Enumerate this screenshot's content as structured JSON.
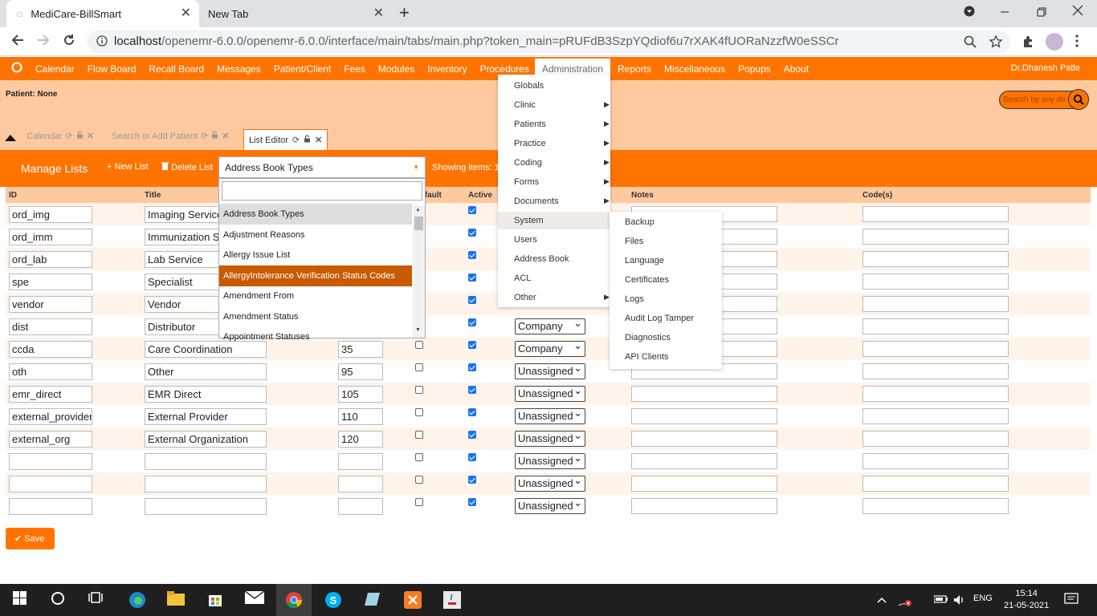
{
  "browser": {
    "tabs": [
      {
        "title": "MediCare-BillSmart"
      },
      {
        "title": "New Tab"
      }
    ],
    "url_host": "localhost",
    "url_path": "/openemr-6.0.0/openemr-6.0.0/interface/main/tabs/main.php?token_main=pRUFdB3SzpYQdiof6u7rXAK4fUORaNzzfW0eSSCr",
    "new_tab_glyph": "+",
    "close_glyph": "✕"
  },
  "menu": {
    "items": [
      "Calendar",
      "Flow Board",
      "Recall Board",
      "Messages",
      "Patient/Client",
      "Fees",
      "Modules",
      "Inventory",
      "Procedures"
    ],
    "active": "Administration",
    "items_after": [
      "Reports",
      "Miscellaneous",
      "Popups",
      "About"
    ],
    "user": "Dr.Dhanesh Patle"
  },
  "patient": {
    "label": "Patient: None",
    "search_placeholder": "Search by any de"
  },
  "page_tabs": [
    {
      "label": "Calendar"
    },
    {
      "label": "Search or Add Patient"
    },
    {
      "label": "List Editor"
    }
  ],
  "list_bar": {
    "title": "Manage Lists",
    "new_list": "New List",
    "delete_list": "Delete List",
    "selected_list": "Address Book Types",
    "showing": "Showing items: 1"
  },
  "table": {
    "headers": {
      "id": "ID",
      "title": "Title",
      "default": "Default",
      "active": "Active",
      "notes": "Notes",
      "codes": "Code(s)"
    },
    "rows": [
      {
        "id": "ord_img",
        "title": "Imaging Service",
        "order": "",
        "active": true,
        "type": ""
      },
      {
        "id": "ord_imm",
        "title": "Immunization Service",
        "order": "",
        "active": true,
        "type": ""
      },
      {
        "id": "ord_lab",
        "title": "Lab Service",
        "order": "",
        "active": true,
        "type": ""
      },
      {
        "id": "spe",
        "title": "Specialist",
        "order": "",
        "active": true,
        "type": ""
      },
      {
        "id": "vendor",
        "title": "Vendor",
        "order": "",
        "active": true,
        "type": ""
      },
      {
        "id": "dist",
        "title": "Distributor",
        "order": "",
        "active": true,
        "type": "Company"
      },
      {
        "id": "ccda",
        "title": "Care Coordination",
        "order": "35",
        "active": true,
        "type": "Company"
      },
      {
        "id": "oth",
        "title": "Other",
        "order": "95",
        "active": true,
        "type": "Unassigned"
      },
      {
        "id": "emr_direct",
        "title": "EMR Direct",
        "order": "105",
        "active": true,
        "type": "Unassigned"
      },
      {
        "id": "external_provider",
        "title": "External Provider",
        "order": "110",
        "active": true,
        "type": "Unassigned"
      },
      {
        "id": "external_org",
        "title": "External Organization",
        "order": "120",
        "active": true,
        "type": "Unassigned"
      },
      {
        "id": "",
        "title": "",
        "order": "",
        "active": true,
        "type": "Unassigned"
      },
      {
        "id": "",
        "title": "",
        "order": "",
        "active": true,
        "type": "Unassigned"
      },
      {
        "id": "",
        "title": "",
        "order": "",
        "active": true,
        "type": "Unassigned"
      }
    ]
  },
  "save_label": "Save",
  "list_dropdown": {
    "options": [
      "Address Book Types",
      "Adjustment Reasons",
      "Allergy Issue List",
      "AllergyIntolerance Verification Status Codes",
      "Amendment From",
      "Amendment Status",
      "Appointment Statuses"
    ],
    "hovered": "Address Book Types",
    "highlighted": "AllergyIntolerance Verification Status Codes"
  },
  "admin_menu": {
    "items": [
      {
        "label": "Globals",
        "submenu": false
      },
      {
        "label": "Clinic",
        "submenu": true
      },
      {
        "label": "Patients",
        "submenu": true
      },
      {
        "label": "Practice",
        "submenu": true
      },
      {
        "label": "Coding",
        "submenu": true
      },
      {
        "label": "Forms",
        "submenu": true
      },
      {
        "label": "Documents",
        "submenu": true
      },
      {
        "label": "System",
        "submenu": false
      },
      {
        "label": "Users",
        "submenu": false
      },
      {
        "label": "Address Book",
        "submenu": false
      },
      {
        "label": "ACL",
        "submenu": false
      },
      {
        "label": "Other",
        "submenu": true
      }
    ],
    "system_submenu": [
      "Backup",
      "Files",
      "Language",
      "Certificates",
      "Logs",
      "Audit Log Tamper",
      "Diagnostics",
      "API Clients"
    ]
  },
  "taskbar": {
    "language": "ENG",
    "time": "15:14",
    "date": "21-05-2021"
  },
  "colors": {
    "accent": "#ff7400",
    "patient_bg": "#ffc9a0",
    "highlight": "#c85a00"
  }
}
